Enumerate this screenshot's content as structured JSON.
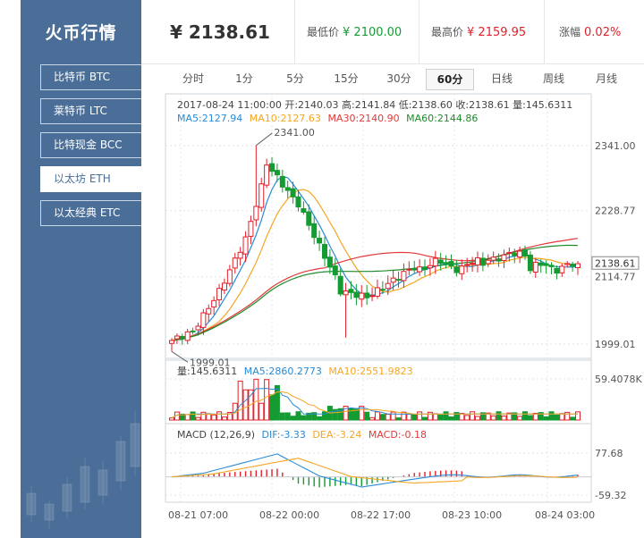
{
  "sidebar": {
    "title": "火币行情",
    "items": [
      {
        "label": "比特币 BTC",
        "active": false
      },
      {
        "label": "莱特币 LTC",
        "active": false
      },
      {
        "label": "比特现金 BCC",
        "active": false
      },
      {
        "label": "以太坊 ETH",
        "active": true
      },
      {
        "label": "以太经典 ETC",
        "active": false
      }
    ]
  },
  "header": {
    "price": "¥ 2138.61",
    "low_label": "最低价",
    "low_value": "¥ 2100.00",
    "high_label": "最高价",
    "high_value": "¥ 2159.95",
    "change_label": "涨幅",
    "change_value": "0.02%"
  },
  "tabs": [
    {
      "label": "分时",
      "active": false
    },
    {
      "label": "1分",
      "active": false
    },
    {
      "label": "5分",
      "active": false
    },
    {
      "label": "15分",
      "active": false
    },
    {
      "label": "30分",
      "active": false
    },
    {
      "label": "60分",
      "active": true
    },
    {
      "label": "日线",
      "active": false
    },
    {
      "label": "周线",
      "active": false
    },
    {
      "label": "月线",
      "active": false
    }
  ],
  "chart_data": {
    "type": "candlestick",
    "info_line": "2017-08-24 11:00:00  开:2140.03 高:2141.84 低:2138.60 收:2138.61 量:145.6311",
    "ma": {
      "ma5": "MA5:2127.94",
      "ma10": "MA10:2127.63",
      "ma30": "MA30:2140.90",
      "ma60": "MA60:2144.86"
    },
    "price_axis": {
      "ticks": [
        "2341.00",
        "2228.77",
        "2114.77",
        "1999.01"
      ],
      "tick_values": [
        2341.0,
        2228.77,
        2114.77,
        1999.01
      ],
      "current": "2138.61",
      "current_value": 2138.61,
      "ylim": [
        1985,
        2370
      ]
    },
    "max_annotation": "2341.00",
    "max_value": 2341.0,
    "min_annotation": "1999.01",
    "min_value": 1999.01,
    "volume": {
      "label": "量:145.6311",
      "ma5": "MA5:2860.2773",
      "ma10": "MA10:2551.9823",
      "axis_max": "59.4078K",
      "axis_max_value": 59407.8
    },
    "macd": {
      "label": "MACD (12,26,9)",
      "dif": "DIF:-3.33",
      "dea": "DEA:-3.24",
      "macd": "MACD:-0.18",
      "axis_top": "77.68",
      "axis_top_value": 77.68,
      "axis_bottom": "-59.32",
      "axis_bottom_value": -59.32
    },
    "time_axis": [
      "08-21 07:00",
      "08-22 00:00",
      "08-22 17:00",
      "08-23 10:00",
      "08-24 03:00"
    ],
    "colors": {
      "up": "#e21f2a",
      "down": "#149b32",
      "ma5": "#2a8bd4",
      "ma10": "#f5a623",
      "ma30": "#e2393a",
      "ma60": "#1f8a2a"
    }
  }
}
